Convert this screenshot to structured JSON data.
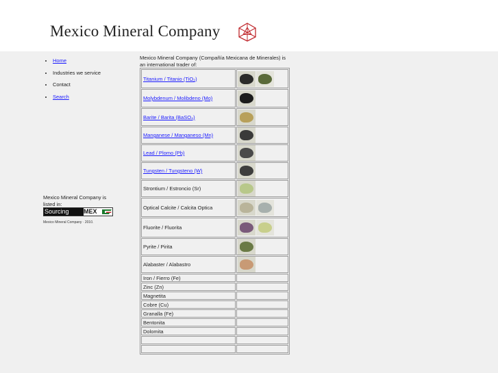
{
  "header": {
    "title": "Mexico Mineral Company"
  },
  "nav": {
    "items": [
      {
        "label": "Home",
        "link": true
      },
      {
        "label": "Industries we service",
        "link": false
      },
      {
        "label": "Contact",
        "link": false
      },
      {
        "label": "Search",
        "link": true
      }
    ]
  },
  "sidebar": {
    "listed_text": "Mexico Mineral Company is listed in:",
    "badge_a": "Sourcing",
    "badge_b": "MEX",
    "copyright": "Mexico Mineral Company · 2010."
  },
  "intro": "Mexico Mineral Company (Compañía Mexicana de Minerales) is an international trader of:",
  "minerals": [
    {
      "name": "Titanium / Titanio (TiO₂)",
      "link": true,
      "photos": [
        "#2b2b2b",
        "#5a6a3a"
      ]
    },
    {
      "name": "Molybdenum / Molibdeno (Mo)",
      "link": true,
      "photos": [
        "#1c1c1c"
      ]
    },
    {
      "name": "Barite / Barita (BaSO₄)",
      "link": true,
      "photos": [
        "#b8a05a"
      ]
    },
    {
      "name": "Manganese / Manganeso (Mn)",
      "link": true,
      "photos": [
        "#3a3a3a"
      ]
    },
    {
      "name": "Lead / Plomo (Pb)",
      "link": true,
      "photos": [
        "#4a4a4a"
      ]
    },
    {
      "name": "Tungsten / Tungsteno (W)",
      "link": true,
      "photos": [
        "#3d3d3d"
      ]
    },
    {
      "name": "Strontium / Estroncio (Sr)",
      "link": false,
      "photos": [
        "#b8c88a"
      ]
    },
    {
      "name": "Optical Calcite / Calcita Optica",
      "link": false,
      "photos": [
        "#b9b49a",
        "#a7b0ad"
      ]
    },
    {
      "name": "Fluorite / Fluorita",
      "link": false,
      "photos": [
        "#7a5a7a",
        "#c8cf8c"
      ]
    },
    {
      "name": "Pyrite / Pirita",
      "link": false,
      "photos": [
        "#6a7a45"
      ]
    },
    {
      "name": "Alabaster / Alabastro",
      "link": false,
      "photos": [
        "#c89a75"
      ]
    },
    {
      "name": "Iron / Fierro (Fe)",
      "link": false,
      "photos": []
    },
    {
      "name": "Zinc (Zn)",
      "link": false,
      "photos": []
    },
    {
      "name": "Magnetita",
      "link": false,
      "photos": []
    },
    {
      "name": "Cobre (Cu)",
      "link": false,
      "photos": []
    },
    {
      "name": "Granalla (Fe)",
      "link": false,
      "photos": []
    },
    {
      "name": "Bentonita",
      "link": false,
      "photos": []
    },
    {
      "name": "Dolomita",
      "link": false,
      "photos": []
    },
    {
      "name": "",
      "link": false,
      "photos": []
    },
    {
      "name": "",
      "link": false,
      "photos": []
    }
  ]
}
